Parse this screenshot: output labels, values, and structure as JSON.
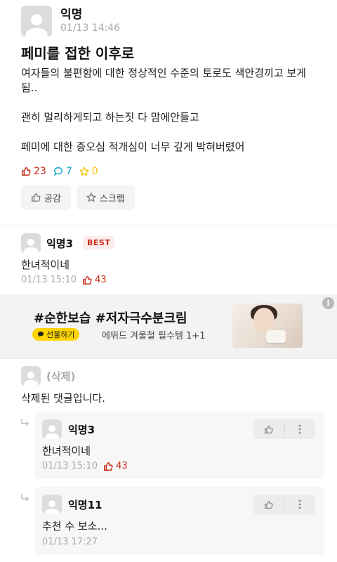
{
  "post": {
    "author": "익명",
    "time": "01/13 14:46",
    "title": "페미를 접한 이후로",
    "body": [
      "여자들의 불편함에 대한 정상적인 수준의 토로도 색안경끼고 보게됨..",
      "괜히 멀리하게되고 하는짓 다 맘에안들고",
      "페미에 대한 증오심 적개심이 너무 깊게 박혀버렸어"
    ],
    "likes": "23",
    "comments": "7",
    "scraps": "0",
    "like_button": "공감",
    "scrap_button": "스크랩"
  },
  "best_comment": {
    "author": "익명3",
    "badge": "BEST",
    "text": "한녀적이네",
    "time": "01/13 15:10",
    "likes": "43"
  },
  "ad": {
    "title": "#순한보습 #저자극수분크림",
    "badge": "선물하기",
    "desc": "에뛰드 겨울철 필수템 1+1",
    "info": "i"
  },
  "deleted_comment": {
    "author": "(삭제)",
    "text": "삭제된 댓글입니다."
  },
  "replies": [
    {
      "author": "익명3",
      "text": "한녀적이네",
      "time": "01/13 15:10",
      "likes": "43"
    },
    {
      "author": "익명11",
      "text": "추천 수 보소...",
      "time": "01/13 17:27",
      "likes": ""
    }
  ],
  "colors": {
    "like": "#c62917",
    "comment": "#0aa5c2",
    "scrap": "#f4c20d",
    "ad_badge": "#ffd400"
  }
}
